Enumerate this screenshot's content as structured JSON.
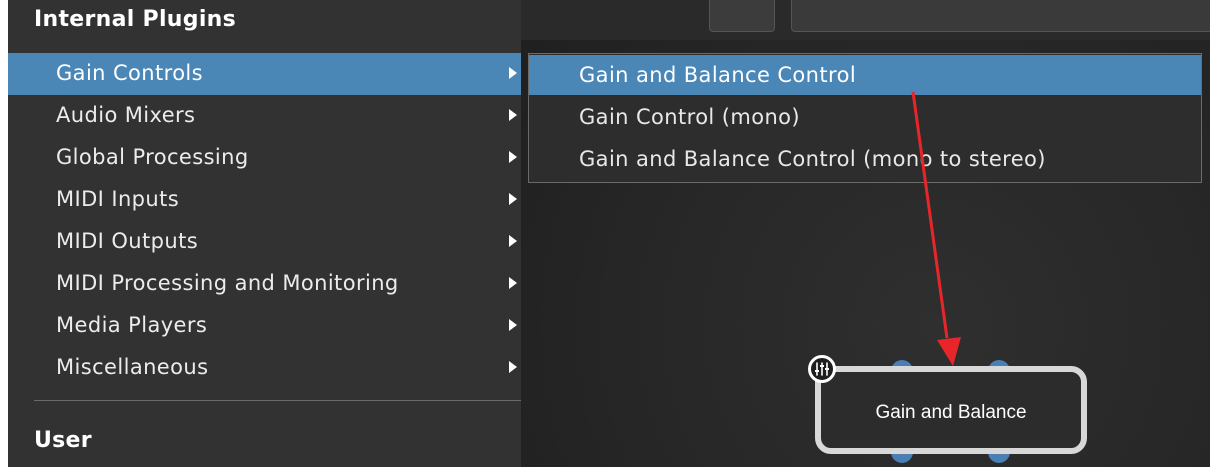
{
  "menu": {
    "header_internal": "Internal Plugins",
    "header_user": "User",
    "items": [
      {
        "label": "Gain Controls"
      },
      {
        "label": "Audio Mixers"
      },
      {
        "label": "Global Processing"
      },
      {
        "label": "MIDI Inputs"
      },
      {
        "label": "MIDI Outputs"
      },
      {
        "label": "MIDI Processing and Monitoring"
      },
      {
        "label": "Media Players"
      },
      {
        "label": "Miscellaneous"
      }
    ],
    "selected_index": 0
  },
  "submenu": {
    "items": [
      {
        "label": "Gain and Balance Control"
      },
      {
        "label": "Gain Control (mono)"
      },
      {
        "label": "Gain and Balance Control (mono to stereo)"
      }
    ],
    "selected_index": 0
  },
  "node": {
    "label": "Gain and Balance",
    "icon": "mixer-sliders-icon"
  },
  "colors": {
    "menu_bg": "#323232",
    "selection": "#4a86b6",
    "pin": "#4a7fb3",
    "annotation_arrow": "#e8262a"
  }
}
